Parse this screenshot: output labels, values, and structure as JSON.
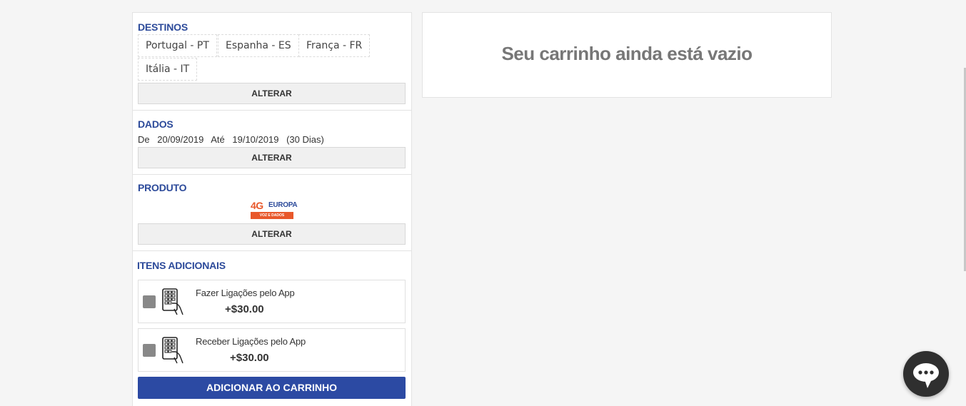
{
  "destinos": {
    "title": "DESTINOS",
    "chips": [
      "Portugal - PT",
      "Espanha - ES",
      "França - FR",
      "Itália - IT"
    ],
    "alter_label": "ALTERAR"
  },
  "dados": {
    "title": "DADOS",
    "from_label": "De",
    "from_date": "20/09/2019",
    "to_label": "Até",
    "to_date": "19/10/2019",
    "duration": "(30 Dias)",
    "alter_label": "ALTERAR"
  },
  "produto": {
    "title": "PRODUTO",
    "logo": {
      "brand_4g": "4G",
      "brand_name": "EUROPA",
      "tagline": "VOZ E DADOS"
    },
    "alter_label": "ALTERAR"
  },
  "itens": {
    "title": "ITENS ADICIONAIS",
    "list": [
      {
        "label": "Fazer Ligações pelo App",
        "price": "+$30.00",
        "checked": false,
        "icon": "phone-keypad-icon"
      },
      {
        "label": "Receber Ligações pelo App",
        "price": "+$30.00",
        "checked": false,
        "icon": "phone-keypad-icon"
      }
    ],
    "add_button": "ADICIONAR AO CARRINHO"
  },
  "cart": {
    "empty_message": "Seu carrinho ainda está vazio"
  },
  "chat": {
    "icon": "chat-bubble-icon"
  },
  "colors": {
    "accent": "#2c4aa3",
    "title_blue": "#2c4a9a",
    "logo_orange": "#e8582b",
    "chat_bg": "#2f2f2f"
  }
}
